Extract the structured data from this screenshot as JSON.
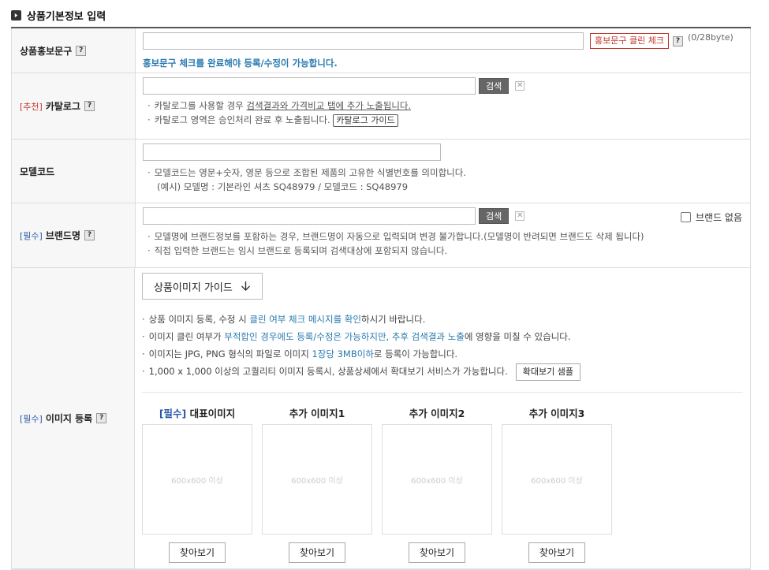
{
  "section_title": "상품기본정보 입력",
  "help_glyph": "?",
  "x_glyph": "✕",
  "promo": {
    "label": "상품홍보문구",
    "value": "",
    "check_button": "홍보문구 클린 체크",
    "byte_count": "(0/28byte)",
    "note": "홍보문구 체크를 완료해야 등록/수정이 가능합니다."
  },
  "catalog": {
    "tag": "[추천]",
    "label": "카탈로그",
    "value": "",
    "search_button": "검색",
    "note1_prefix": "카탈로그를 사용할 경우 ",
    "note1_link": "검색결과와 가격비교 탭에 추가 노출됩니다.",
    "note2": "카탈로그 영역은 승인처리 완료 후 노출됩니다.",
    "guide_button": "카탈로그 가이드"
  },
  "model": {
    "label": "모델코드",
    "value": "",
    "note1": "모델코드는 영문+숫자, 영문 등으로 조합된 제품의 고유한 식별번호를 의미합니다.",
    "note2": "(예시) 모델명 : 기본라인 셔츠 SQ48979 / 모델코드 : SQ48979"
  },
  "brand": {
    "tag": "[필수]",
    "label": "브랜드명",
    "value": "",
    "search_button": "검색",
    "no_brand_label": "브랜드 없음",
    "no_brand_checked": false,
    "note1": "모델명에 브랜드정보를 포함하는 경우, 브랜드명이 자동으로 입력되며 변경 불가합니다.(모델명이 반려되면 브랜드도 삭제 됩니다)",
    "note2": "직접 입력한 브랜드는 임시 브랜드로 등록되며 검색대상에 포함되지 않습니다."
  },
  "image": {
    "tag": "[필수]",
    "label": "이미지 등록",
    "guide_button": "상품이미지 가이드",
    "note1_a": "상품 이미지 등록, 수정 시 ",
    "note1_hl": "클린 여부 체크 메시지를 확인",
    "note1_b": "하시기 바랍니다.",
    "note2_a": "이미지 클린 여부가 ",
    "note2_hl": "부적합인 경우에도 등록/수정은 가능하지만, 추후 검색결과 노출",
    "note2_b": "에 영향을 미칠 수 있습니다.",
    "note3_a": "이미지는 JPG, PNG 형식의 파일로 이미지 ",
    "note3_hl": "1장당 3MB이하",
    "note3_b": "로 등록이 가능합니다.",
    "note4": "1,000 x 1,000 이상의 고퀄리티 이미지 등록시, 상품상세에서 확대보기 서비스가 가능합니다.",
    "zoom_sample_button": "확대보기 샘플",
    "slots": [
      {
        "req": "[필수]",
        "title": " 대표이미지",
        "placeholder": "600x600 이상",
        "button": "찾아보기"
      },
      {
        "req": "",
        "title": "추가 이미지1",
        "placeholder": "600x600 이상",
        "button": "찾아보기"
      },
      {
        "req": "",
        "title": "추가 이미지2",
        "placeholder": "600x600 이상",
        "button": "찾아보기"
      },
      {
        "req": "",
        "title": "추가 이미지3",
        "placeholder": "600x600 이상",
        "button": "찾아보기"
      }
    ]
  }
}
